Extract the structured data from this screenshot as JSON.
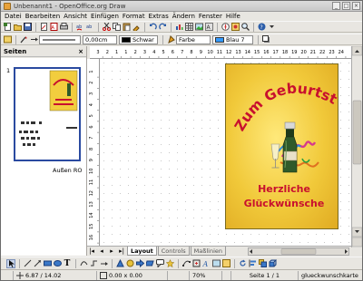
{
  "window": {
    "title": "Unbenannt1 - OpenOffice.org Draw",
    "min": "_",
    "max": "□",
    "close": "×"
  },
  "menu": [
    "Datei",
    "Bearbeiten",
    "Ansicht",
    "Einfügen",
    "Format",
    "Extras",
    "Ändern",
    "Fenster",
    "Hilfe"
  ],
  "line_props": {
    "line_width": "0,00cm",
    "line_color_name": "Schwar",
    "line_color_hex": "#000000",
    "area_style": "Farbe",
    "area_color_name": "Blau 7",
    "area_color_hex": "#3399ff"
  },
  "slides_panel": {
    "title": "Seiten",
    "close": "×",
    "slide_number": "1",
    "slide_label": "Außen RO"
  },
  "card": {
    "headline": "Zum Geburtstag",
    "greeting_line1": "Herzliche",
    "greeting_line2": "Glückwünsche",
    "text_color": "#c8102e"
  },
  "ruler_h_labels": [
    "3",
    "2",
    "1",
    "1",
    "2",
    "3",
    "4",
    "5",
    "6",
    "7",
    "8",
    "9",
    "10",
    "11",
    "12",
    "13",
    "14",
    "15",
    "16",
    "17",
    "18",
    "19",
    "20",
    "21",
    "22",
    "23",
    "24"
  ],
  "ruler_v_labels": [
    "1",
    "2",
    "3",
    "4",
    "5",
    "6",
    "7",
    "8",
    "9",
    "10",
    "11",
    "12",
    "13",
    "14",
    "15",
    "16"
  ],
  "tabs": [
    "Layout",
    "Controls",
    "Maßlinien"
  ],
  "active_tab": "Layout",
  "status": {
    "position": "6.87 / 14.02",
    "size": "0.00 x 0.00",
    "zoom": "70%",
    "page": "Seite 1 / 1",
    "layout_name": "glueckwunschkarte"
  }
}
